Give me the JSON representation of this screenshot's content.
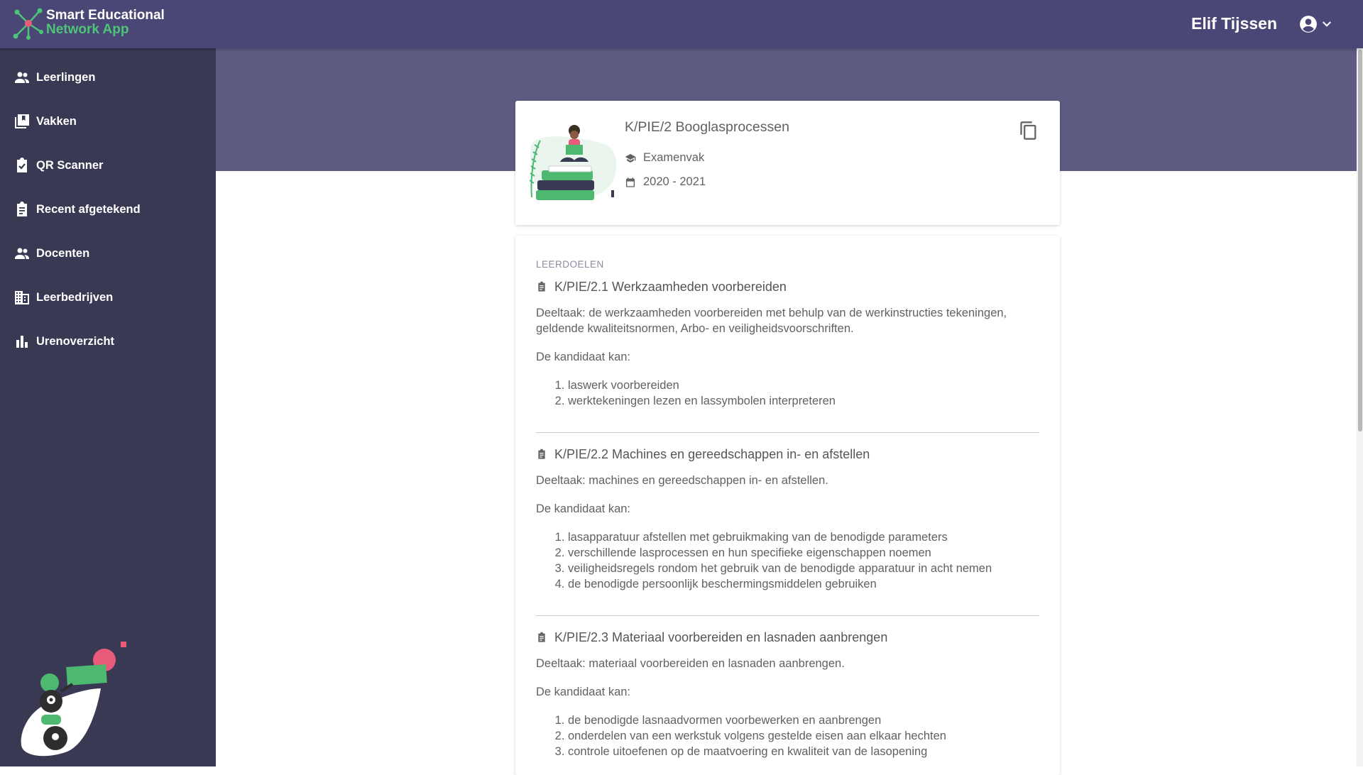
{
  "app": {
    "brand_line1": "Smart Educational",
    "brand_line2": "Network App",
    "user_name": "Elif Tijssen"
  },
  "colors": {
    "topbar": "#4a4675",
    "sidebar": "#3a3953",
    "hero": "#5e5b82",
    "brand_green": "#4cc577"
  },
  "sidebar": {
    "items": [
      {
        "label": "Leerlingen",
        "icon": "people-icon"
      },
      {
        "label": "Vakken",
        "icon": "library-books-icon"
      },
      {
        "label": "QR Scanner",
        "icon": "assignment-check-icon"
      },
      {
        "label": "Recent afgetekend",
        "icon": "assignment-icon"
      },
      {
        "label": "Docenten",
        "icon": "people-icon"
      },
      {
        "label": "Leerbedrijven",
        "icon": "building-icon"
      },
      {
        "label": "Urenoverzicht",
        "icon": "bar-chart-icon"
      }
    ]
  },
  "subject": {
    "title": "K/PIE/2 Booglasprocessen",
    "type": "Examenvak",
    "year": "2020 - 2021"
  },
  "learning_goals": {
    "section_label": "LEERDOELEN",
    "goals": [
      {
        "title": "K/PIE/2.1 Werkzaamheden voorbereiden",
        "description": "Deeltaak: de werkzaamheden voorbereiden met behulp van de werkinstructies tekeningen, geldende kwaliteitsnormen, Arbo- en veiligheidsvoorschriften.",
        "intro": "De kandidaat kan:",
        "items": [
          "laswerk voorbereiden",
          "werktekeningen lezen en lassymbolen interpreteren"
        ]
      },
      {
        "title": "K/PIE/2.2 Machines en gereedschappen in- en afstellen",
        "description": "Deeltaak: machines en gereedschappen in- en afstellen.",
        "intro": "De kandidaat kan:",
        "items": [
          "lasapparatuur afstellen met gebruikmaking van de benodigde parameters",
          "verschillende lasprocessen en hun specifieke eigenschappen noemen",
          "veiligheidsregels rondom het gebruik van de benodigde apparatuur in acht nemen",
          "de benodigde persoonlijk beschermingsmiddelen gebruiken"
        ]
      },
      {
        "title": "K/PIE/2.3 Materiaal voorbereiden en lasnaden aanbrengen",
        "description": "Deeltaak: materiaal voorbereiden en lasnaden aanbrengen.",
        "intro": "De kandidaat kan:",
        "items": [
          "de benodigde lasnaadvormen voorbewerken en aanbrengen",
          "onderdelen van een werkstuk volgens gestelde eisen aan elkaar hechten",
          "controle uitoefenen op de maatvoering en kwaliteit van de lasopening"
        ]
      }
    ]
  }
}
